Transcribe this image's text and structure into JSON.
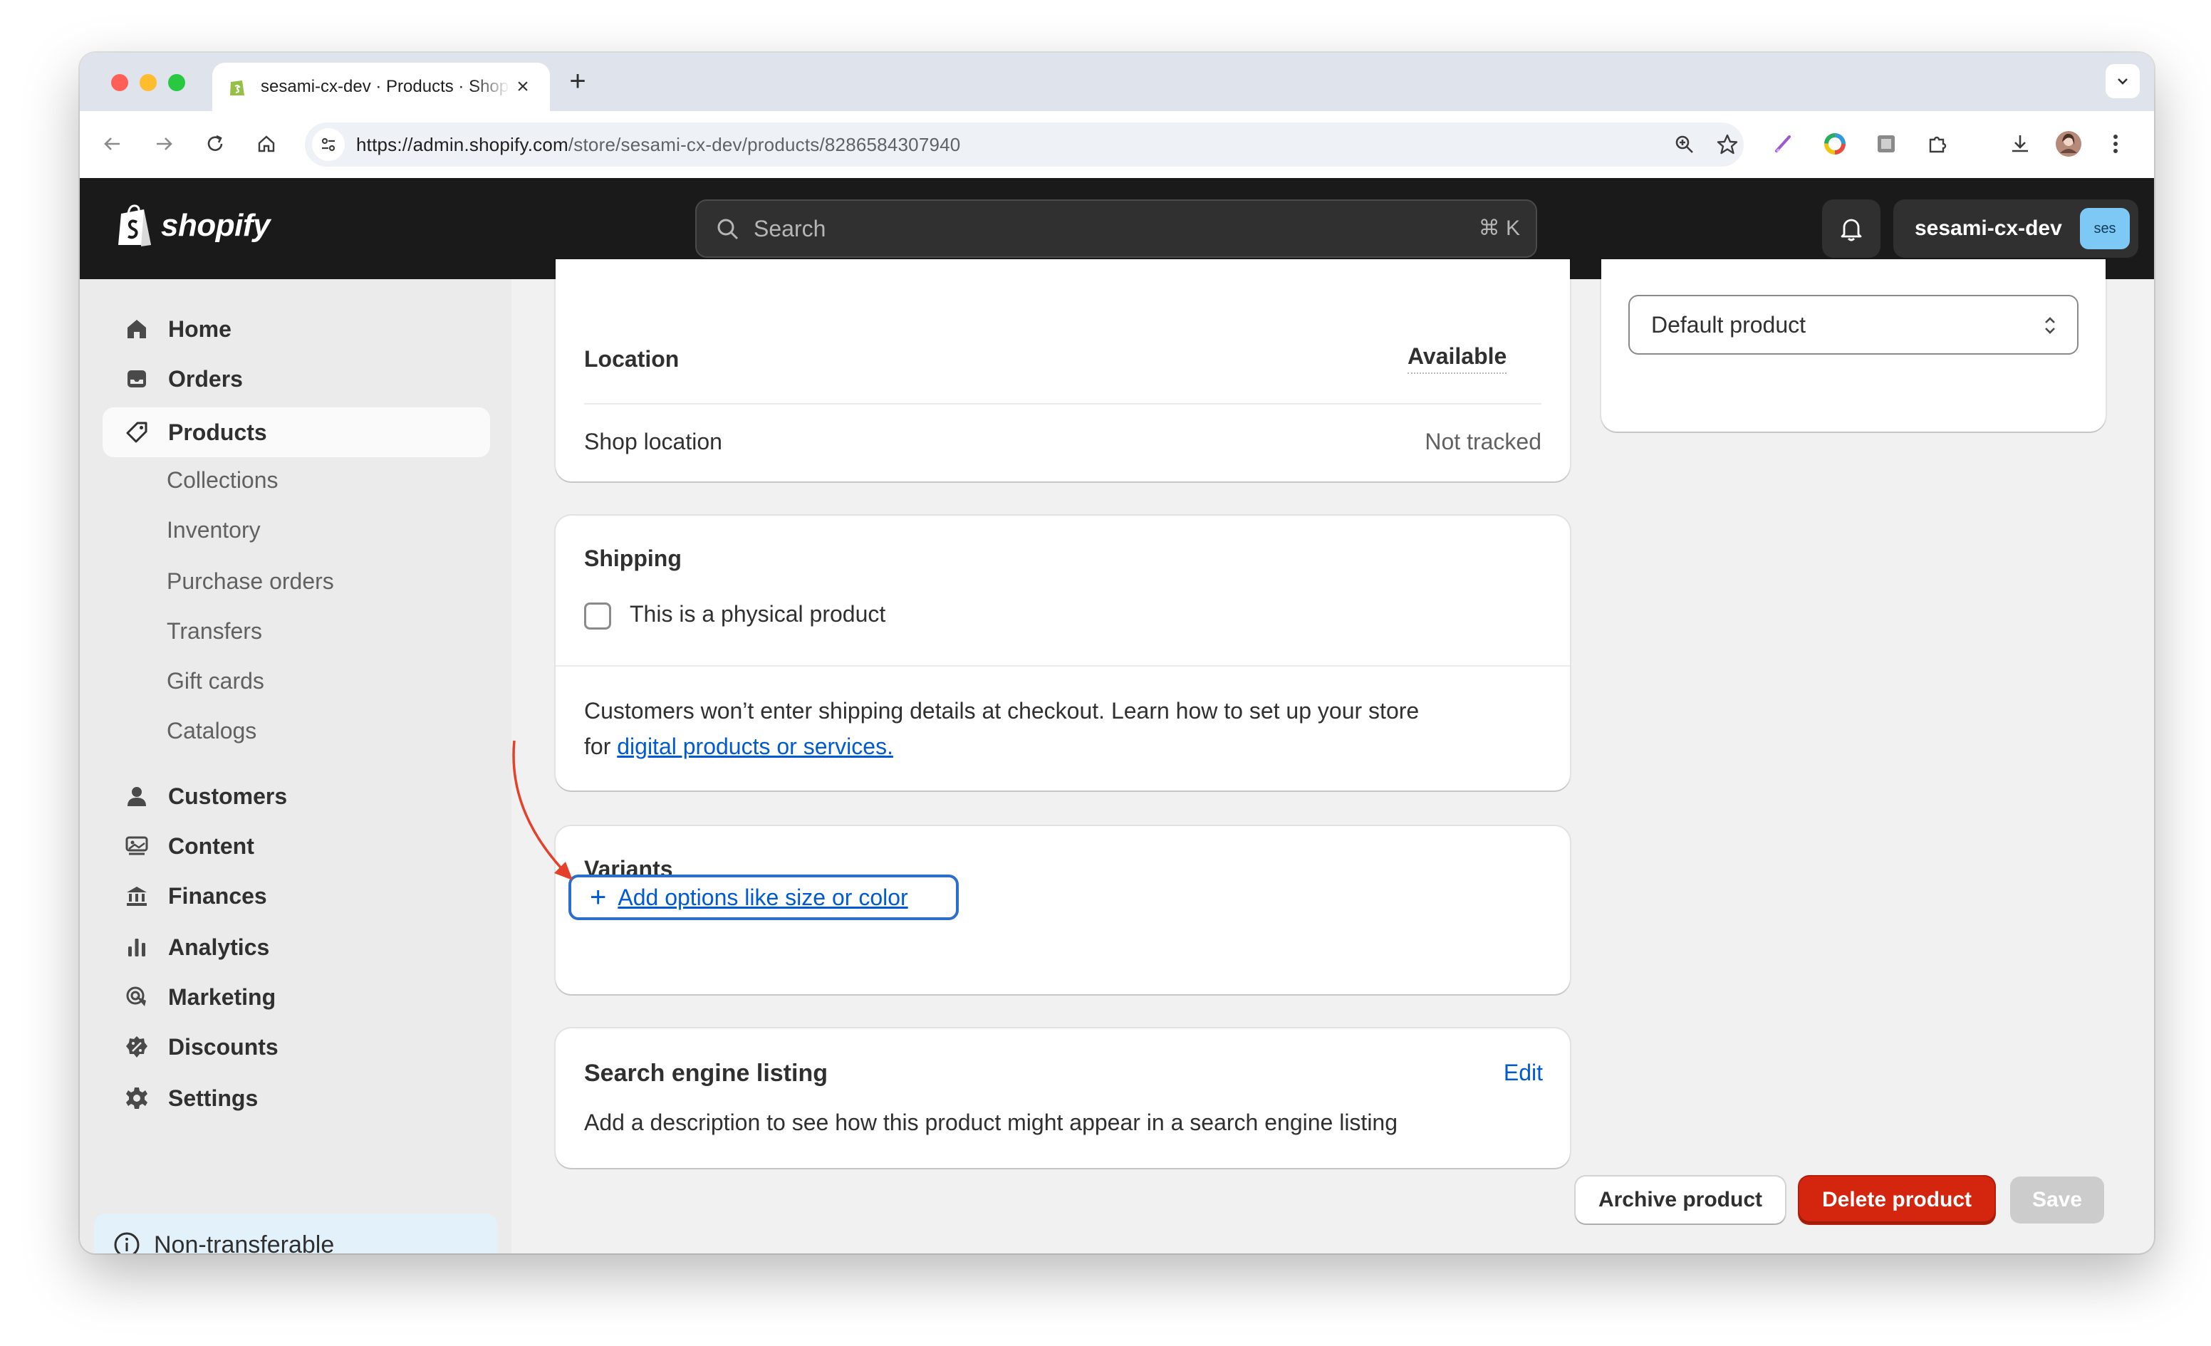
{
  "browser": {
    "tab_title": "sesami-cx-dev · Products · Shopify",
    "url_host": "https://admin.shopify.com",
    "url_path": "/store/sesami-cx-dev/products/8286584307940",
    "new_tab_label": "+",
    "close_label": "×"
  },
  "topbar": {
    "logo_text": "shopify",
    "search_placeholder": "Search",
    "search_shortcut": "⌘ K",
    "store_name": "sesami-cx-dev",
    "store_avatar": "ses"
  },
  "sidebar": {
    "items": [
      {
        "label": "Home",
        "icon": "home-icon"
      },
      {
        "label": "Orders",
        "icon": "inbox-icon"
      },
      {
        "label": "Products",
        "icon": "tag-icon",
        "active": true
      }
    ],
    "sub_items": [
      "Collections",
      "Inventory",
      "Purchase orders",
      "Transfers",
      "Gift cards",
      "Catalogs"
    ],
    "items2": [
      {
        "label": "Customers",
        "icon": "person-icon"
      },
      {
        "label": "Content",
        "icon": "content-icon"
      },
      {
        "label": "Finances",
        "icon": "bank-icon"
      },
      {
        "label": "Analytics",
        "icon": "bar-chart-icon"
      },
      {
        "label": "Marketing",
        "icon": "target-icon"
      },
      {
        "label": "Discounts",
        "icon": "discount-icon"
      },
      {
        "label": "Settings",
        "icon": "gear-icon"
      }
    ],
    "banner": "Non-transferable"
  },
  "inventory_card": {
    "col_location": "Location",
    "col_available": "Available",
    "row_location": "Shop location",
    "row_value": "Not tracked"
  },
  "shipping_card": {
    "title": "Shipping",
    "checkbox_label": "This is a physical product",
    "info_line1": "Customers won’t enter shipping details at checkout. Learn how to set up your store",
    "info_for": "for ",
    "info_link": "digital products or services."
  },
  "variants_card": {
    "title": "Variants",
    "add_plus": "+",
    "add_label": "Add options like size or color"
  },
  "seo_card": {
    "title": "Search engine listing",
    "edit_label": "Edit",
    "description": "Add a description to see how this product might appear in a search engine listing"
  },
  "right_card": {
    "template_value": "Default product"
  },
  "actions": {
    "archive": "Archive product",
    "delete": "Delete product",
    "save": "Save"
  },
  "colors": {
    "accent_link": "#005bd3",
    "delete": "#d4260f",
    "annotation_arrow": "#e5402a"
  }
}
